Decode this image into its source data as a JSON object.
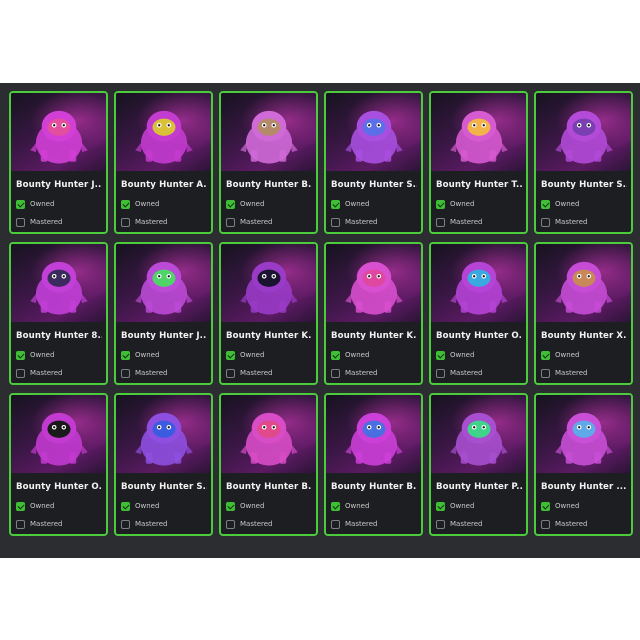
{
  "cards": [
    {
      "name": "Bounty Hunter J...",
      "owned_label": "Owned",
      "mastered_label": "Mastered",
      "owned": true,
      "mastered": false,
      "icon": "bounty-hunter-sunglasses-icon",
      "accent": "#d23fd6",
      "face": "#e34f9e"
    },
    {
      "name": "Bounty Hunter A...",
      "owned_label": "Owned",
      "mastered_label": "Mastered",
      "owned": true,
      "mastered": false,
      "icon": "bounty-hunter-hooded-icon",
      "accent": "#c43bd0",
      "face": "#d9c23a"
    },
    {
      "name": "Bounty Hunter B...",
      "owned_label": "Owned",
      "mastered_label": "Mastered",
      "owned": true,
      "mastered": false,
      "icon": "bounty-hunter-bear-icon",
      "accent": "#d06ad8",
      "face": "#b48a6a"
    },
    {
      "name": "Bounty Hunter S...",
      "owned_label": "Owned",
      "mastered_label": "Mastered",
      "owned": true,
      "mastered": false,
      "icon": "bounty-hunter-sonic-icon",
      "accent": "#a94fe0",
      "face": "#5b6fe8"
    },
    {
      "name": "Bounty Hunter T...",
      "owned_label": "Owned",
      "mastered_label": "Mastered",
      "owned": true,
      "mastered": false,
      "icon": "bounty-hunter-tails-icon",
      "accent": "#d65ad0",
      "face": "#f2b34a"
    },
    {
      "name": "Bounty Hunter S...",
      "owned_label": "Owned",
      "mastered_label": "Mastered",
      "owned": true,
      "mastered": false,
      "icon": "bounty-hunter-shadow-icon",
      "accent": "#b34ad8",
      "face": "#7a3fb0"
    },
    {
      "name": "Bounty Hunter 8...",
      "owned_label": "Owned",
      "mastered_label": "Mastered",
      "owned": true,
      "mastered": false,
      "icon": "bounty-hunter-robot-icon",
      "accent": "#c23fd8",
      "face": "#3b2a5e"
    },
    {
      "name": "Bounty Hunter J...",
      "owned_label": "Owned",
      "mastered_label": "Mastered",
      "owned": true,
      "mastered": false,
      "icon": "bounty-hunter-bunny-icon",
      "accent": "#bb4ad6",
      "face": "#4fd46a"
    },
    {
      "name": "Bounty Hunter K...",
      "owned_label": "Owned",
      "mastered_label": "Mastered",
      "owned": true,
      "mastered": false,
      "icon": "bounty-hunter-ninja-icon",
      "accent": "#9a3bc8",
      "face": "#1b1430"
    },
    {
      "name": "Bounty Hunter K...",
      "owned_label": "Owned",
      "mastered_label": "Mastered",
      "owned": true,
      "mastered": false,
      "icon": "bounty-hunter-crab-icon",
      "accent": "#d84fcf",
      "face": "#e0479f"
    },
    {
      "name": "Bounty Hunter O...",
      "owned_label": "Owned",
      "mastered_label": "Mastered",
      "owned": true,
      "mastered": false,
      "icon": "bounty-hunter-visor-icon",
      "accent": "#b543d6",
      "face": "#3aa9e0"
    },
    {
      "name": "Bounty Hunter X...",
      "owned_label": "Owned",
      "mastered_label": "Mastered",
      "owned": true,
      "mastered": false,
      "icon": "bounty-hunter-goggles-icon",
      "accent": "#c64cd6",
      "face": "#c98858"
    },
    {
      "name": "Bounty Hunter O...",
      "owned_label": "Owned",
      "mastered_label": "Mastered",
      "owned": true,
      "mastered": false,
      "icon": "bounty-hunter-blob-icon",
      "accent": "#c23ad0",
      "face": "#1a1a1a"
    },
    {
      "name": "Bounty Hunter S...",
      "owned_label": "Owned",
      "mastered_label": "Mastered",
      "owned": true,
      "mastered": false,
      "icon": "bounty-hunter-blue-icon",
      "accent": "#8e4fe0",
      "face": "#3b5be0"
    },
    {
      "name": "Bounty Hunter B...",
      "owned_label": "Owned",
      "mastered_label": "Mastered",
      "owned": true,
      "mastered": false,
      "icon": "bounty-hunter-angry-icon",
      "accent": "#d84cc6",
      "face": "#e04a8a"
    },
    {
      "name": "Bounty Hunter B...",
      "owned_label": "Owned",
      "mastered_label": "Mastered",
      "owned": true,
      "mastered": false,
      "icon": "bounty-hunter-spiky-icon",
      "accent": "#cc3fd8",
      "face": "#4a6fe0"
    },
    {
      "name": "Bounty Hunter P...",
      "owned_label": "Owned",
      "mastered_label": "Mastered",
      "owned": true,
      "mastered": false,
      "icon": "bounty-hunter-hat-icon",
      "accent": "#a84fd0",
      "face": "#3fd48a"
    },
    {
      "name": "Bounty Hunter ...",
      "owned_label": "Owned",
      "mastered_label": "Mastered",
      "owned": true,
      "mastered": false,
      "icon": "bounty-hunter-masked-icon",
      "accent": "#c84fd6",
      "face": "#5fa9e8"
    }
  ]
}
